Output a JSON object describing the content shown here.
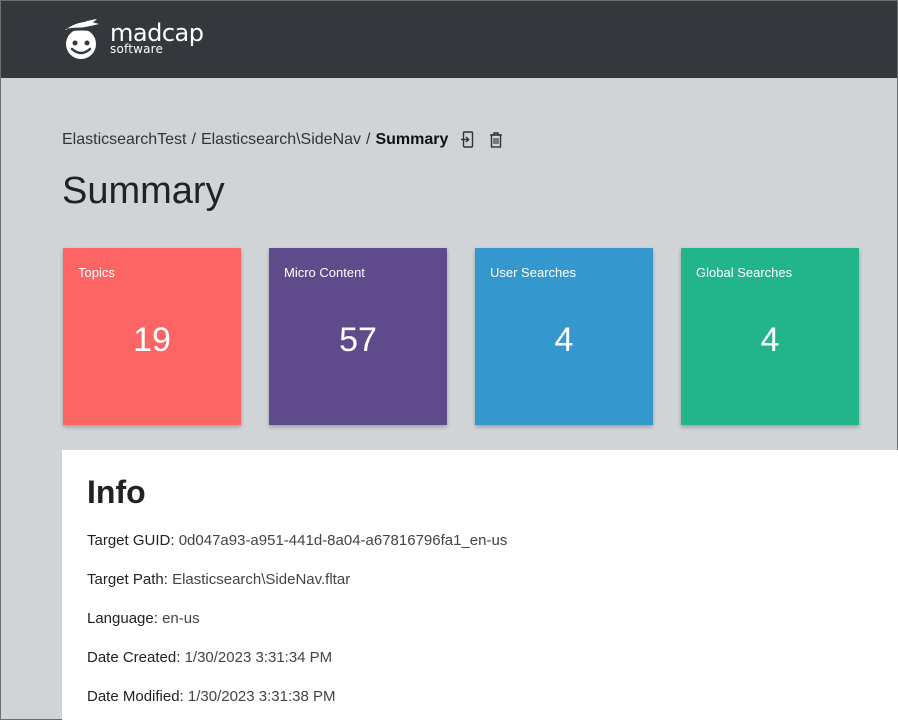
{
  "brand": {
    "name": "madcap",
    "sub": "software",
    "icon": "madcap-propeller-logo-icon"
  },
  "breadcrumb": {
    "items": [
      "ElasticsearchTest",
      "Elasticsearch\\SideNav"
    ],
    "current": "Summary",
    "separator": "/",
    "icons": [
      "export-icon",
      "trash-icon"
    ]
  },
  "page": {
    "title": "Summary"
  },
  "tiles": [
    {
      "label": "Topics",
      "value": "19",
      "color": "#fd6464"
    },
    {
      "label": "Micro Content",
      "value": "57",
      "color": "#5f4a8b"
    },
    {
      "label": "User Searches",
      "value": "4",
      "color": "#3498cf"
    },
    {
      "label": "Global Searches",
      "value": "4",
      "color": "#22b48b"
    }
  ],
  "info": {
    "title": "Info",
    "rows": [
      {
        "key": "Target GUID:",
        "value": "0d047a93-a951-441d-8a04-a67816796fa1_en-us"
      },
      {
        "key": "Target Path:",
        "value": "Elasticsearch\\SideNav.fltar"
      },
      {
        "key": "Language:",
        "value": "en-us"
      },
      {
        "key": "Date Created:",
        "value": "1/30/2023 3:31:34 PM"
      },
      {
        "key": "Date Modified:",
        "value": "1/30/2023 3:31:38 PM"
      }
    ]
  }
}
